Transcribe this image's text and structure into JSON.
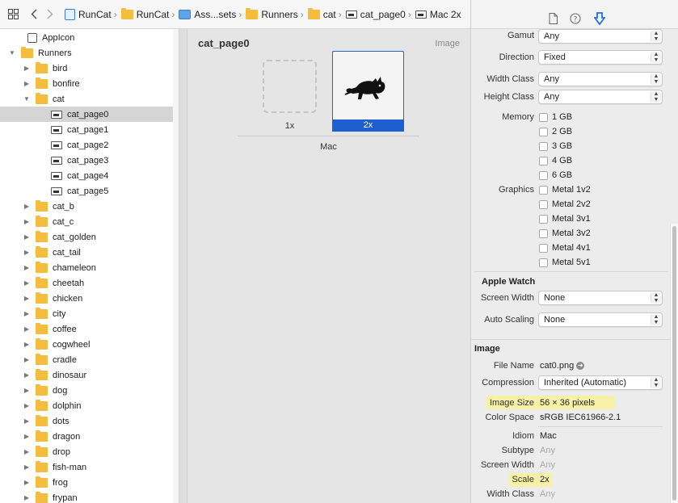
{
  "jumpbar": {
    "crumbs": [
      "RunCat",
      "RunCat",
      "Ass...sets",
      "Runners",
      "cat",
      "cat_page0",
      "Mac 2x"
    ]
  },
  "navigator": {
    "appicon_label": "AppIcon",
    "runners_label": "Runners",
    "cat_label": "cat",
    "before_cat": [
      "bird",
      "bonfire"
    ],
    "cat_children": [
      "cat_page0",
      "cat_page1",
      "cat_page2",
      "cat_page3",
      "cat_page4",
      "cat_page5"
    ],
    "after_cat": [
      "cat_b",
      "cat_c",
      "cat_golden",
      "cat_tail",
      "chameleon",
      "cheetah",
      "chicken",
      "city",
      "coffee",
      "cogwheel",
      "cradle",
      "dinosaur",
      "dog",
      "dolphin",
      "dots",
      "dragon",
      "drop",
      "fish-man",
      "frog",
      "frypan"
    ],
    "selected": "cat_page0"
  },
  "editor": {
    "title": "cat_page0",
    "type": "Image",
    "slot_1x": "1x",
    "slot_2x": "2x",
    "device": "Mac"
  },
  "inspector": {
    "gamut": {
      "label": "Gamut",
      "value": "Any"
    },
    "direction": {
      "label": "Direction",
      "value": "Fixed"
    },
    "width_class": {
      "label": "Width Class",
      "value": "Any"
    },
    "height_class": {
      "label": "Height Class",
      "value": "Any"
    },
    "memory": {
      "label": "Memory",
      "options": [
        "1 GB",
        "2 GB",
        "3 GB",
        "4 GB",
        "6 GB"
      ]
    },
    "graphics": {
      "label": "Graphics",
      "options": [
        "Metal 1v2",
        "Metal 2v2",
        "Metal 3v1",
        "Metal 3v2",
        "Metal 4v1",
        "Metal 5v1"
      ]
    },
    "apple_watch": {
      "title": "Apple Watch",
      "screen_width": {
        "label": "Screen Width",
        "value": "None"
      },
      "auto_scaling": {
        "label": "Auto Scaling",
        "value": "None"
      }
    },
    "image": {
      "title": "Image",
      "file_name": {
        "label": "File Name",
        "value": "cat0.png"
      },
      "compression": {
        "label": "Compression",
        "value": "Inherited (Automatic)"
      },
      "image_size": {
        "label": "Image Size",
        "value": "56 × 36 pixels"
      },
      "color_space": {
        "label": "Color Space",
        "value": "sRGB IEC61966-2.1"
      },
      "idiom": {
        "label": "Idiom",
        "value": "Mac"
      },
      "subtype": {
        "label": "Subtype",
        "value": "Any"
      },
      "screen_width": {
        "label": "Screen Width",
        "value": "Any"
      },
      "scale": {
        "label": "Scale",
        "value": "2x"
      },
      "width_class": {
        "label": "Width Class",
        "value": "Any"
      }
    }
  },
  "colors": {
    "selection_blue": "#1d5fd1",
    "highlight_yellow": "#f6f0a9",
    "folder_yellow": "#f4bd3f"
  },
  "icons": [
    "grid-icon",
    "back-icon",
    "forward-icon",
    "file-inspector-icon",
    "help-icon",
    "attributes-inspector-icon"
  ]
}
